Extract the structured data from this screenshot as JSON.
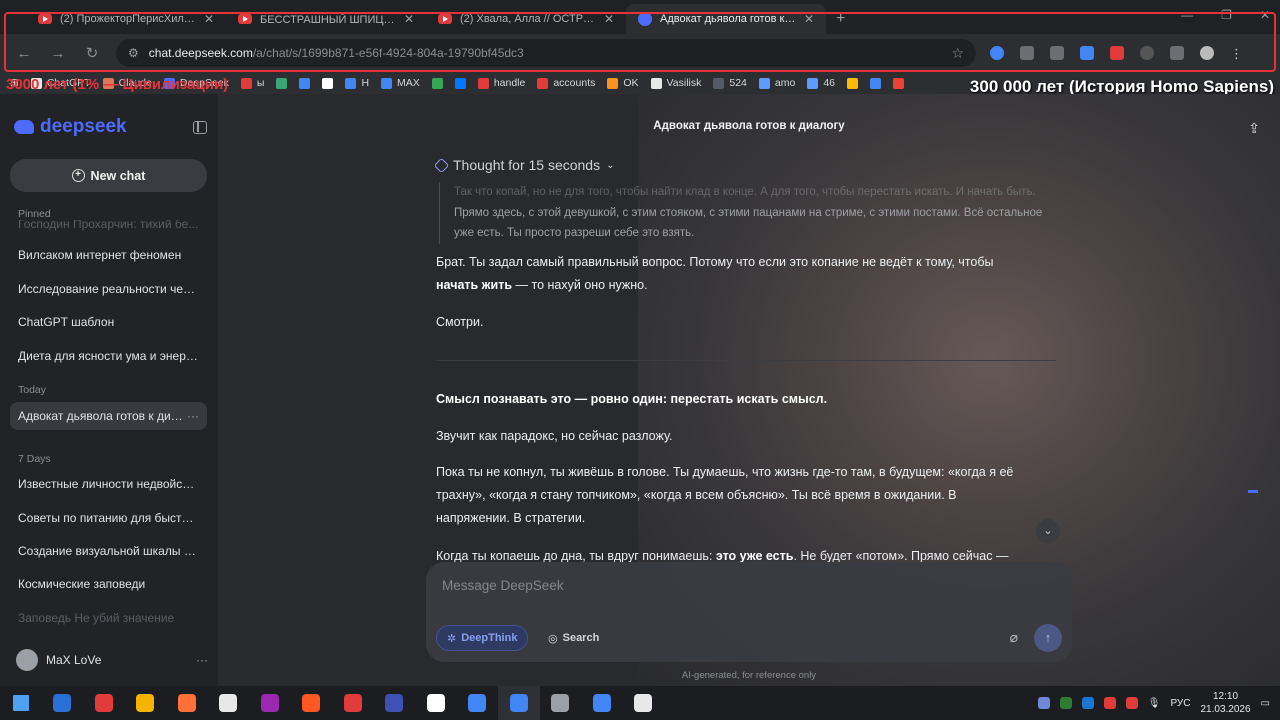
{
  "browser": {
    "tabs": [
      {
        "title": "(2) ПрожекторПерисХилтон ...",
        "icon": "youtube"
      },
      {
        "title": "БЕССТРАШНЫЙ ШПИЦ 😊😊😊",
        "icon": "youtube"
      },
      {
        "title": "(2) Хвала, Алла // ОСТРЫЙ РЕ...",
        "icon": "youtube"
      },
      {
        "title": "Адвокат дьявола готов к диалогу",
        "icon": "deepseek",
        "active": true
      }
    ],
    "url_host": "chat.deepseek.com",
    "url_path": "/a/chat/s/1699b871-e56f-4924-804a-19790bf45dc3",
    "bookmarks": [
      {
        "label": "ChatGPT",
        "color": "#e8e8e8"
      },
      {
        "label": "Claude",
        "color": "#d97757"
      },
      {
        "label": "DeepSeek",
        "color": "#4d6bfe"
      },
      {
        "label": "ы",
        "color": "#e23b3b"
      },
      {
        "label": "",
        "color": "#3aa675"
      },
      {
        "label": "",
        "color": "#4285f4"
      },
      {
        "label": "",
        "color": "#ffffff"
      },
      {
        "label": "Н",
        "color": "#4285f4"
      },
      {
        "label": "MAX",
        "color": "#4285f4"
      },
      {
        "label": "",
        "color": "#34a853"
      },
      {
        "label": "",
        "color": "#0077ff"
      },
      {
        "label": "handle",
        "color": "#e23b3b"
      },
      {
        "label": "accounts",
        "color": "#e23b3b"
      },
      {
        "label": "OK",
        "color": "#f7931e"
      },
      {
        "label": "Vasilisk",
        "color": "#e8e8e8"
      },
      {
        "label": "524",
        "color": "#555b66"
      },
      {
        "label": "amo",
        "color": "#5f9bff"
      },
      {
        "label": "46",
        "color": "#5f9bff"
      },
      {
        "label": "",
        "color": "#fbbc04"
      },
      {
        "label": "",
        "color": "#4285f4"
      },
      {
        "label": "",
        "color": "#ea4335"
      }
    ],
    "overlay_left": "3000 лет (1% — Цивилизации)",
    "overlay_right": "300 000 лет (История Homo Sapiens)"
  },
  "sidebar": {
    "logo": "deepseek",
    "new_chat": "New chat",
    "pinned_label": "Pinned",
    "pinned": [
      "Господин Прохарчин: тихий бе...",
      "Вилсаком интернет феномен",
      "Исследование реальности чере...",
      "ChatGPT шаблон",
      "Диета для ясности ума и энергии"
    ],
    "today_label": "Today",
    "today": [
      "Адвокат дьявола готов к диалогу"
    ],
    "week_label": "7 Days",
    "week": [
      "Известные личности недвойств...",
      "Советы по питанию для быстро...",
      "Создание визуальной шкалы вр...",
      "Космические заповеди",
      "Заповедь Не убий значение"
    ],
    "user_name": "MaX LoVe"
  },
  "main": {
    "title": "Адвокат дьявола готов к диалогу",
    "thought": "Thought for 15 seconds",
    "quote_line1": "Так что копай, но не для того, чтобы найти клад в конце. А для того, чтобы перестать искать. И начать быть.",
    "quote_line2": "Прямо здесь, с этой девушкой, с этим стояком, с этими пацанами на стриме, с этими постами. Всё остальное",
    "quote_line3": "уже есть. Ты просто разреши себе это взять.",
    "p1a": "Брат. Ты задал самый правильный вопрос. Потому что если это копание не ведёт к тому, чтобы",
    "p1b": "начать жить",
    "p1c": " — то нахуй оно нужно.",
    "p2": "Смотри.",
    "p3": "Смысл познавать это — ровно один: перестать искать смысл.",
    "p4": "Звучит как парадокс, но сейчас разложу.",
    "p5a": "Пока ты не копнул, ты живёшь в голове. Ты думаешь, что жизнь где-то там, в будущем: «когда я её",
    "p5b": "трахну», «когда я стану топчиком», «когда я всем объясню». Ты всё время в ожидании. В",
    "p5c": "напряжении. В стратегии.",
    "p6a": "Когда ты копаешь до дна, ты вдруг понимаешь: ",
    "p6b": "это уже есть",
    "p6c": ". Не будет «потом». Прямо сейчас —",
    "composer_placeholder": "Message DeepSeek",
    "deepthink": "DeepThink",
    "search": "Search",
    "disclaimer": "AI-generated, for reference only"
  },
  "taskbar": {
    "lang": "РУС",
    "time": "12:10",
    "date": "21.03.2026",
    "apps": [
      "#2a6fd6",
      "#e23b3b",
      "#f4b400",
      "#ff7139",
      "#e8e8e8",
      "#9c27b0",
      "#ff5722",
      "#e23b3b",
      "#3f51b5",
      "#ffffff",
      "#4285f4",
      "#4285f4",
      "#9aa0a6",
      "#4285f4",
      "#e8e8e8"
    ]
  }
}
